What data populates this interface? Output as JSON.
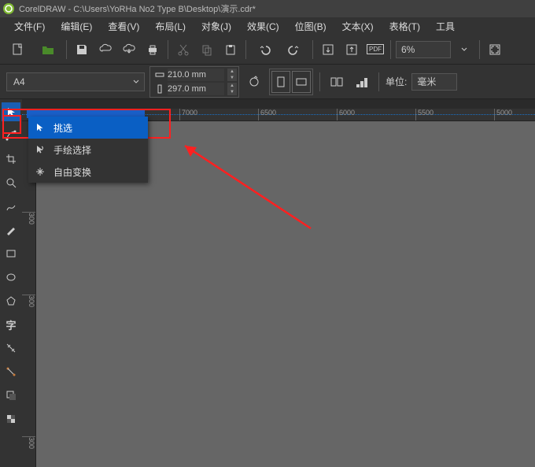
{
  "title": "CorelDRAW  -  C:\\Users\\YoRHa No2 Type B\\Desktop\\演示.cdr*",
  "menu": [
    "文件(F)",
    "编辑(E)",
    "查看(V)",
    "布局(L)",
    "对象(J)",
    "效果(C)",
    "位图(B)",
    "文本(X)",
    "表格(T)",
    "工具"
  ],
  "toolbar": {
    "zoom_value": "6%"
  },
  "properties": {
    "paper": "A4",
    "dims": {
      "w": "210.0 mm",
      "h": "297.0 mm"
    },
    "unit_label": "单位:",
    "unit_value": "毫米"
  },
  "ruler_h": [
    "7000",
    "6500",
    "6000",
    "5500",
    "5000"
  ],
  "ruler_v": [
    "300",
    "300",
    "300"
  ],
  "flyout": {
    "items": [
      {
        "label": "挑选"
      },
      {
        "label": "手绘选择"
      },
      {
        "label": "自由变换"
      }
    ]
  }
}
